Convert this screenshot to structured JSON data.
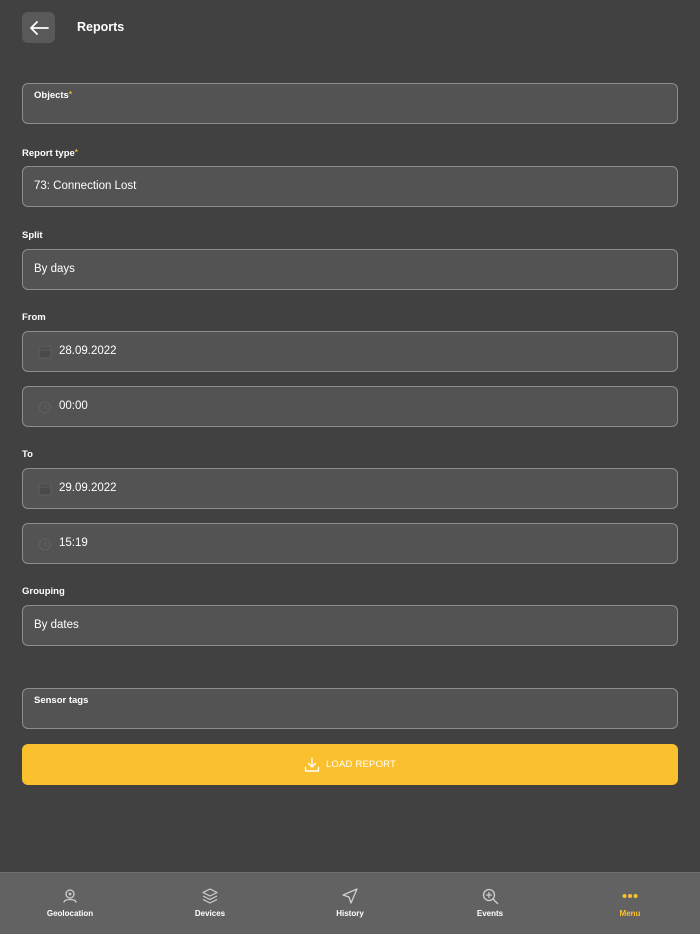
{
  "header": {
    "title": "Reports"
  },
  "form": {
    "objects": {
      "label": "Objects",
      "required_mark": "*",
      "value": ""
    },
    "report_type": {
      "label": "Report type",
      "required_mark": "*",
      "value": "73: Connection Lost"
    },
    "split": {
      "label": "Split",
      "value": "By days"
    },
    "from": {
      "label": "From",
      "date": "28.09.2022",
      "time": "00:00"
    },
    "to": {
      "label": "To",
      "date": "29.09.2022",
      "time": "15:19"
    },
    "grouping": {
      "label": "Grouping",
      "value": "By dates"
    },
    "sensor_tags": {
      "label": "Sensor tags",
      "value": ""
    },
    "load_button": {
      "label": "LOAD REPORT"
    }
  },
  "nav": {
    "items": [
      {
        "label": "Geolocation",
        "icon": "geolocation-icon"
      },
      {
        "label": "Devices",
        "icon": "layers-icon"
      },
      {
        "label": "History",
        "icon": "navigation-arrow-icon"
      },
      {
        "label": "Events",
        "icon": "zoom-in-icon"
      },
      {
        "label": "Menu",
        "icon": "more-dots-icon",
        "active": true
      }
    ]
  },
  "colors": {
    "background": "#414141",
    "field": "#535353",
    "accent": "#fbc02d",
    "nav_bar": "#626262"
  }
}
